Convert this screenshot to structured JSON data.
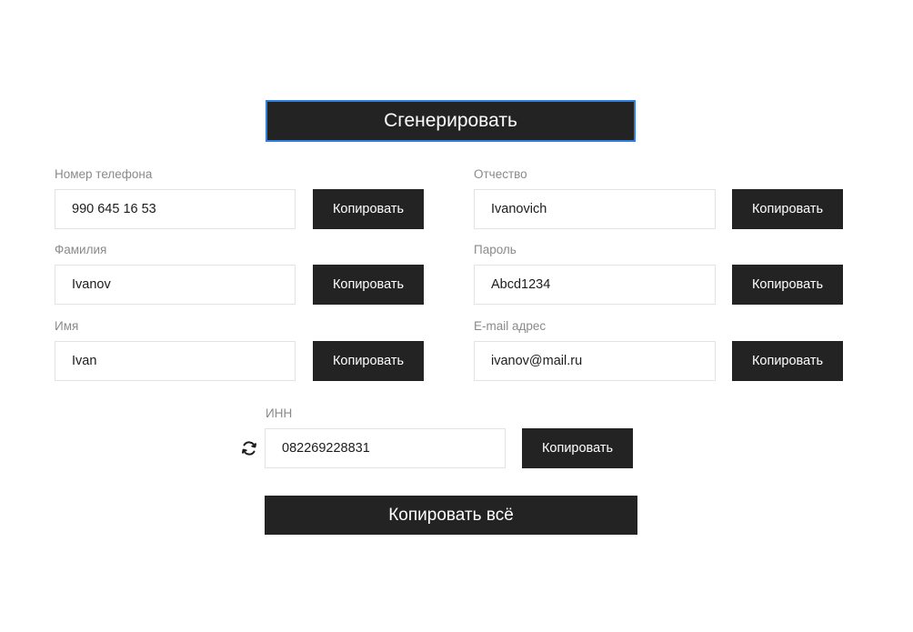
{
  "generate_button": "Сгенерировать",
  "copy_label": "Копировать",
  "copy_all_button": "Копировать всё",
  "fields": {
    "phone": {
      "label": "Номер телефона",
      "value": "990 645 16 53"
    },
    "surname": {
      "label": "Фамилия",
      "value": "Ivanov"
    },
    "name": {
      "label": "Имя",
      "value": "Ivan"
    },
    "patronymic": {
      "label": "Отчество",
      "value": "Ivanovich"
    },
    "password": {
      "label": "Пароль",
      "value": "Abcd1234"
    },
    "email": {
      "label": "E-mail адрес",
      "value": "ivanov@mail.ru"
    },
    "inn": {
      "label": "ИНН",
      "value": "082269228831"
    }
  },
  "icons": {
    "refresh": "refresh-icon"
  },
  "colors": {
    "button_bg": "#232323",
    "button_text": "#ffffff",
    "focus_border": "#2f7fe0",
    "label_text": "#8a8a8a",
    "input_border": "#e3e3e3"
  }
}
